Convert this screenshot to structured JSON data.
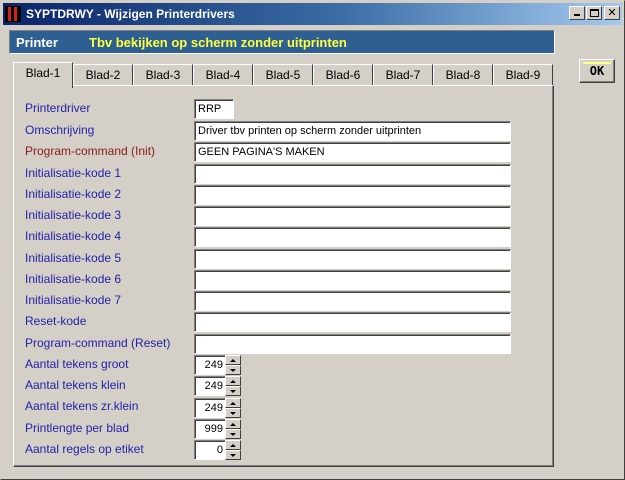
{
  "window": {
    "title": "SYPTDRWY - Wijzigen Printerdrivers",
    "icon": "app-icon",
    "controls": [
      "minimize-icon",
      "maximize-icon",
      "close-icon"
    ],
    "close_glyph": "✕"
  },
  "banner": {
    "label": "Printer",
    "description": "Tbv bekijken op scherm zonder uitprinten"
  },
  "ok_button": {
    "label": "OK"
  },
  "tabs": [
    {
      "label": "Blad-1",
      "active": true
    },
    {
      "label": "Blad-2"
    },
    {
      "label": "Blad-3"
    },
    {
      "label": "Blad-4"
    },
    {
      "label": "Blad-5"
    },
    {
      "label": "Blad-6"
    },
    {
      "label": "Blad-7"
    },
    {
      "label": "Blad-8"
    },
    {
      "label": "Blad-9"
    }
  ],
  "form": {
    "printerdriver": {
      "label": "Printerdriver",
      "value": "RRP"
    },
    "omschrijving": {
      "label": "Omschrijving",
      "value": "Driver tbv printen op scherm zonder uitprinten"
    },
    "program_command_init": {
      "label": "Program-command (Init)",
      "value": "GEEN PAGINA'S MAKEN"
    },
    "init_kode_1": {
      "label": "Initialisatie-kode 1",
      "value": ""
    },
    "init_kode_2": {
      "label": "Initialisatie-kode 2",
      "value": ""
    },
    "init_kode_3": {
      "label": "Initialisatie-kode 3",
      "value": ""
    },
    "init_kode_4": {
      "label": "Initialisatie-kode 4",
      "value": ""
    },
    "init_kode_5": {
      "label": "Initialisatie-kode 5",
      "value": ""
    },
    "init_kode_6": {
      "label": "Initialisatie-kode 6",
      "value": ""
    },
    "init_kode_7": {
      "label": "Initialisatie-kode 7",
      "value": ""
    },
    "reset_kode": {
      "label": "Reset-kode",
      "value": ""
    },
    "program_command_reset": {
      "label": "Program-command (Reset)",
      "value": ""
    },
    "tekens_groot": {
      "label": "Aantal tekens groot",
      "value": "249"
    },
    "tekens_klein": {
      "label": "Aantal tekens klein",
      "value": "249"
    },
    "tekens_zr_klein": {
      "label": "Aantal tekens zr.klein",
      "value": "249"
    },
    "printlengte": {
      "label": "Printlengte per blad",
      "value": "999"
    },
    "regels_etiket": {
      "label": "Aantal regels op etiket",
      "value": "0"
    }
  },
  "colors": {
    "label_blue": "#2323a8",
    "label_dark_red": "#8b1a1a",
    "banner_bg": "#2e5f93",
    "banner_desc": "#ffff3c",
    "window_bg": "#d4d0c8"
  }
}
